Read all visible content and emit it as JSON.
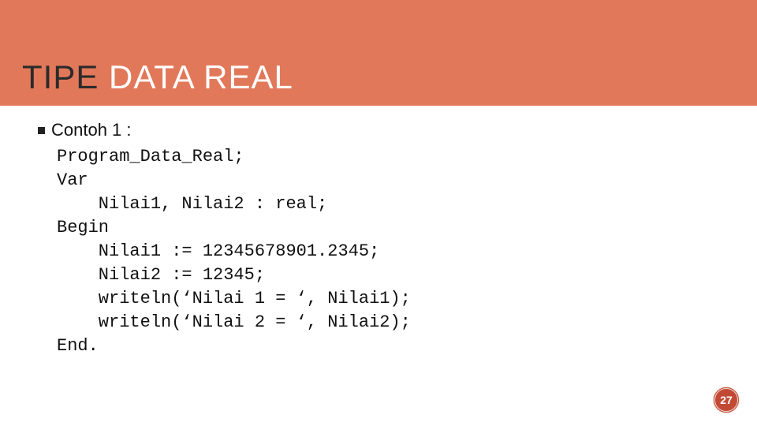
{
  "title": {
    "accent_part": "TIPE ",
    "main_part": "DATA REAL"
  },
  "bullet": {
    "label": "Contoh 1 :"
  },
  "code": {
    "line1": "Program_Data_Real;",
    "line2": "Var",
    "line3": "    Nilai1, Nilai2 : real;",
    "line4": "Begin",
    "line5": "    Nilai1 := 12345678901.2345;",
    "line6": "    Nilai2 := 12345;",
    "line7": "    writeln(‘Nilai 1 = ‘, Nilai1);",
    "line8": "    writeln(‘Nilai 2 = ‘, Nilai2);",
    "line9": "End."
  },
  "page_number": "27"
}
